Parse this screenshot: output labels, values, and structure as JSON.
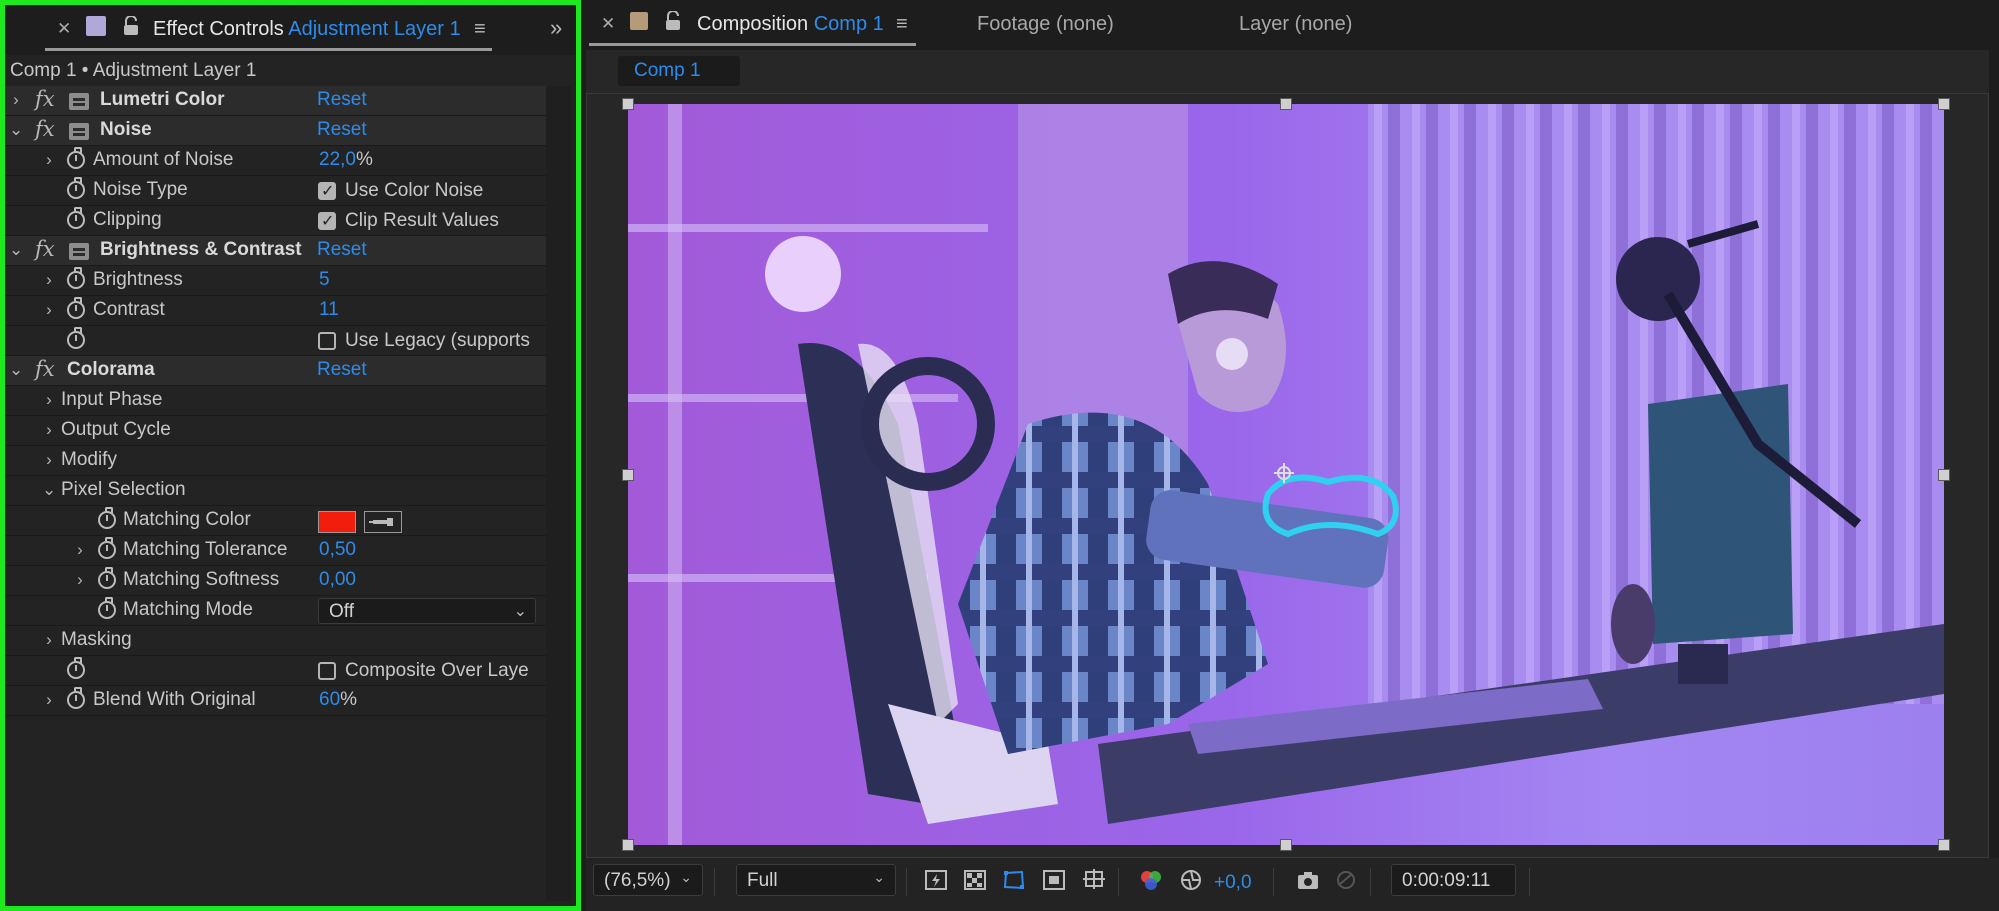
{
  "effect_controls": {
    "tab_label": "Effect Controls",
    "tab_layer": "Adjustment Layer 1",
    "breadcrumb": "Comp 1 • Adjustment Layer 1",
    "reset_label": "Reset",
    "lumetri": {
      "name": "Lumetri Color"
    },
    "noise": {
      "name": "Noise",
      "amount_label": "Amount of Noise",
      "amount_value": "22,0",
      "amount_unit": "%",
      "type_label": "Noise Type",
      "type_value": "Use Color Noise",
      "clipping_label": "Clipping",
      "clipping_value": "Clip Result Values"
    },
    "brightness_contrast": {
      "name": "Brightness & Contrast",
      "brightness_label": "Brightness",
      "brightness_value": "5",
      "contrast_label": "Contrast",
      "contrast_value": "11",
      "legacy_label": "Use Legacy (supports"
    },
    "colorama": {
      "name": "Colorama",
      "input_phase": "Input Phase",
      "output_cycle": "Output Cycle",
      "modify": "Modify",
      "pixel_selection": "Pixel Selection",
      "matching_color_label": "Matching Color",
      "matching_color_value": "#f21d0d",
      "matching_tolerance_label": "Matching Tolerance",
      "matching_tolerance_value": "0,50",
      "matching_softness_label": "Matching Softness",
      "matching_softness_value": "0,00",
      "matching_mode_label": "Matching Mode",
      "matching_mode_value": "Off",
      "masking": "Masking",
      "composite_label": "Composite Over Laye",
      "blend_label": "Blend With Original",
      "blend_value": "60",
      "blend_unit": "%"
    }
  },
  "composition": {
    "tab_label": "Composition",
    "tab_comp": "Comp 1",
    "footage_label": "Footage",
    "footage_value": "(none)",
    "layer_label": "Layer",
    "layer_value": "(none)",
    "comp_tab": "Comp 1"
  },
  "viewer_bar": {
    "zoom": "(76,5%)",
    "resolution": "Full",
    "exposure": "+0,0",
    "timecode": "0:00:09:11"
  },
  "colors": {
    "accent": "#2d8ceb",
    "highlight_border": "#1ee81e",
    "panel_bg": "#232323"
  }
}
